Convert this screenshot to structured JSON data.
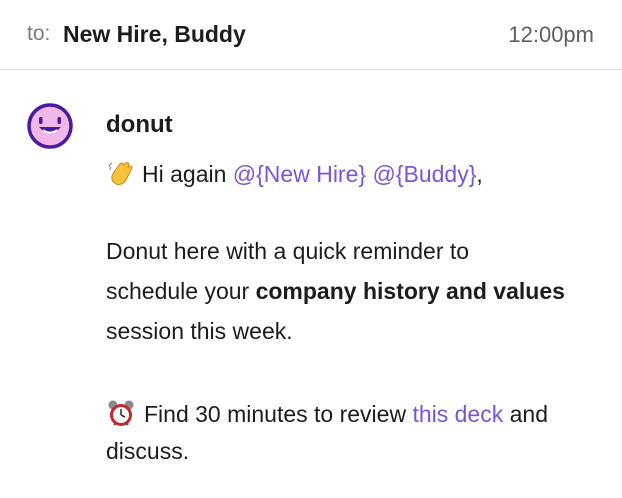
{
  "header": {
    "to_label": "to:",
    "recipient_1": "New Hire",
    "separator": ",",
    "recipient_2": "Buddy",
    "time": "12:00pm"
  },
  "message": {
    "sender": "donut",
    "greeting_prefix": "Hi again ",
    "mention_new_hire": "@{New Hire}",
    "space": " ",
    "mention_buddy": "@{Buddy}",
    "greeting_suffix": ",",
    "para1_line1": "Donut here with a quick reminder to",
    "para1_line2_prefix": "schedule your ",
    "para1_line2_bold": "company history and values",
    "para1_line3": "session this week.",
    "para2_line1_prefix": "Find 30 minutes to review ",
    "para2_link": "this deck",
    "para2_line1_suffix": " and",
    "para2_line2": "discuss."
  },
  "icons": {
    "avatar": "donut-smiley-avatar",
    "greeting_emoji": "waving-hand-icon",
    "reminder_emoji": "alarm-clock-icon"
  },
  "colors": {
    "avatar_purple": "#4a1b9c",
    "avatar_pink": "#f0b7e8",
    "mention": "#7a55d6",
    "divider": "#e2e2e2"
  }
}
